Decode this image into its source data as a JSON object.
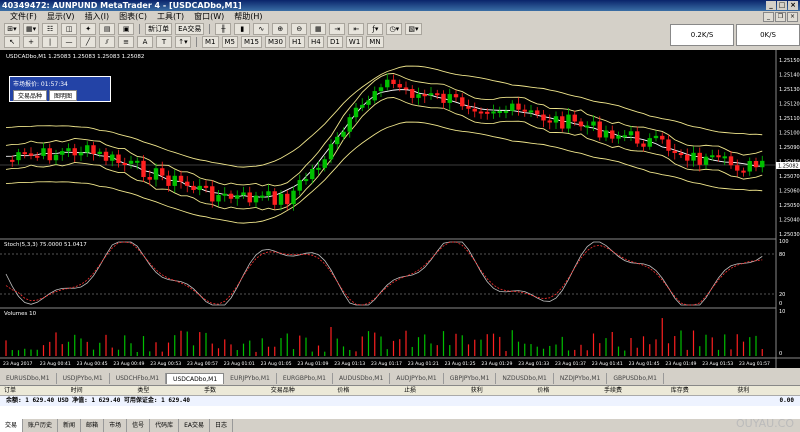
{
  "window": {
    "title": "40349472: AUNPUND MetaTrader 4 - [USDCADbo,M1]"
  },
  "menu": [
    "文件(F)",
    "显示(V)",
    "插入(I)",
    "图表(C)",
    "工具(T)",
    "窗口(W)",
    "帮助(H)"
  ],
  "toolbar1": {
    "new_order": "新订单",
    "expert_advisors": "EA交易",
    "zoom": "0.2K/S",
    "quote_right": "0K/S"
  },
  "timeframes": [
    "M1",
    "M5",
    "M15",
    "M30",
    "H1",
    "H4",
    "D1",
    "W1",
    "MN"
  ],
  "popup": {
    "title": "市场报价: 01:57:34",
    "btn_symbols": "交易品种",
    "btn_chart": "图明图"
  },
  "charts": {
    "main_label": "USDCADbo,M1 1.25083 1.25083 1.25083 1.25082",
    "stoch_label": "Stoch(5,3,3) 75.0000 51.0417",
    "volumes_label": "Volumes 10",
    "price_ticks": [
      "1.25150",
      "1.25140",
      "1.25130",
      "1.25120",
      "1.25110",
      "1.25100",
      "1.25090",
      "1.25080",
      "1.25070",
      "1.25060",
      "1.25050",
      "1.25040",
      "1.25030"
    ],
    "current_price": "1.25082",
    "stoch_ticks": [
      "100",
      "80",
      "20",
      "0"
    ],
    "vol_ticks": [
      "10",
      "0"
    ],
    "time_labels": [
      "23 Aug 2017",
      "23 Aug 00:41",
      "23 Aug 00:45",
      "23 Aug 00:49",
      "23 Aug 00:53",
      "23 Aug 00:57",
      "23 Aug 01:01",
      "23 Aug 01:05",
      "23 Aug 01:09",
      "23 Aug 01:13",
      "23 Aug 01:17",
      "23 Aug 01:21",
      "23 Aug 01:25",
      "23 Aug 01:29",
      "23 Aug 01:33",
      "23 Aug 01:37",
      "23 Aug 01:41",
      "23 Aug 01:45",
      "23 Aug 01:49",
      "23 Aug 01:53",
      "23 Aug 01:57"
    ]
  },
  "symbol_tabs": [
    "EURUSDbo,M1",
    "USDJPYbo,M1",
    "USDCHFbo,M1",
    "USDCADbo,M1",
    "EURJPYbo,M1",
    "EURGBPbo,M1",
    "AUDUSDbo,M1",
    "AUDJPYbo,M1",
    "GBPJPYbo,M1",
    "NZDUSDbo,M1",
    "NZDJPYbo,M1",
    "GBPUSDbo,M1"
  ],
  "active_symbol_tab": "USDCADbo,M1",
  "terminal": {
    "columns": [
      "订单",
      "时间",
      "类型",
      "手数",
      "交易品种",
      "价格",
      "止损",
      "获利",
      "价格",
      "手续费",
      "库存费",
      "获利"
    ],
    "balance_row": "余额: 1 629.40 USD  净值: 1 629.40  可用保证金: 1 629.40",
    "profit": "0.00"
  },
  "bottom_tabs": [
    "交易",
    "账户历史",
    "新闻",
    "邮箱",
    "市场",
    "信号",
    "代码库",
    "EA交易",
    "日志"
  ],
  "watermark": "OUYAU.CO"
}
